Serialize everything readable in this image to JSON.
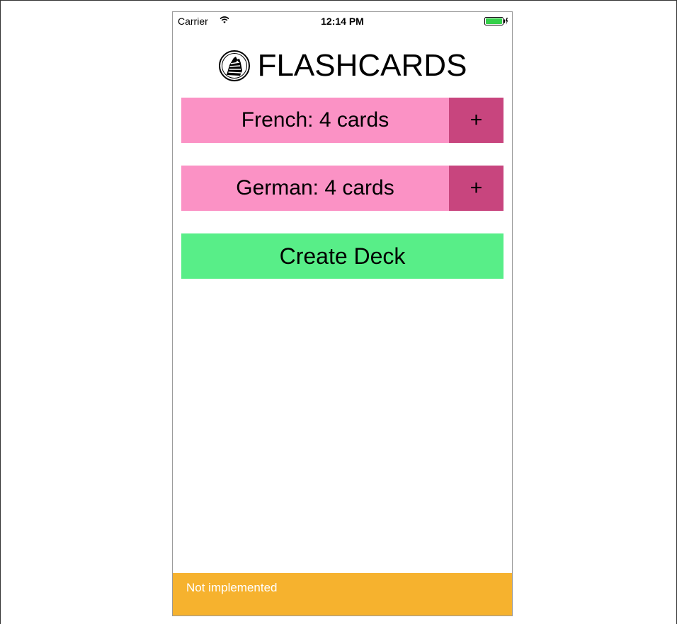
{
  "status_bar": {
    "carrier": "Carrier",
    "time": "12:14 PM",
    "wifi_icon": "wifi-icon",
    "battery_icon": "battery-charging-icon",
    "battery_color": "#35d04a"
  },
  "header": {
    "logo_icon": "zebra-logo-icon",
    "title": "FLASHCARDS"
  },
  "decks": [
    {
      "label": "French: 4 cards",
      "add_label": "+"
    },
    {
      "label": "German: 4 cards",
      "add_label": "+"
    }
  ],
  "create_deck": {
    "label": "Create Deck"
  },
  "footer": {
    "message": "Not implemented"
  },
  "colors": {
    "deck_bg": "#fb92c5",
    "deck_add_bg": "#c8457e",
    "create_bg": "#58ee88",
    "footer_bg": "#f6b22e"
  }
}
